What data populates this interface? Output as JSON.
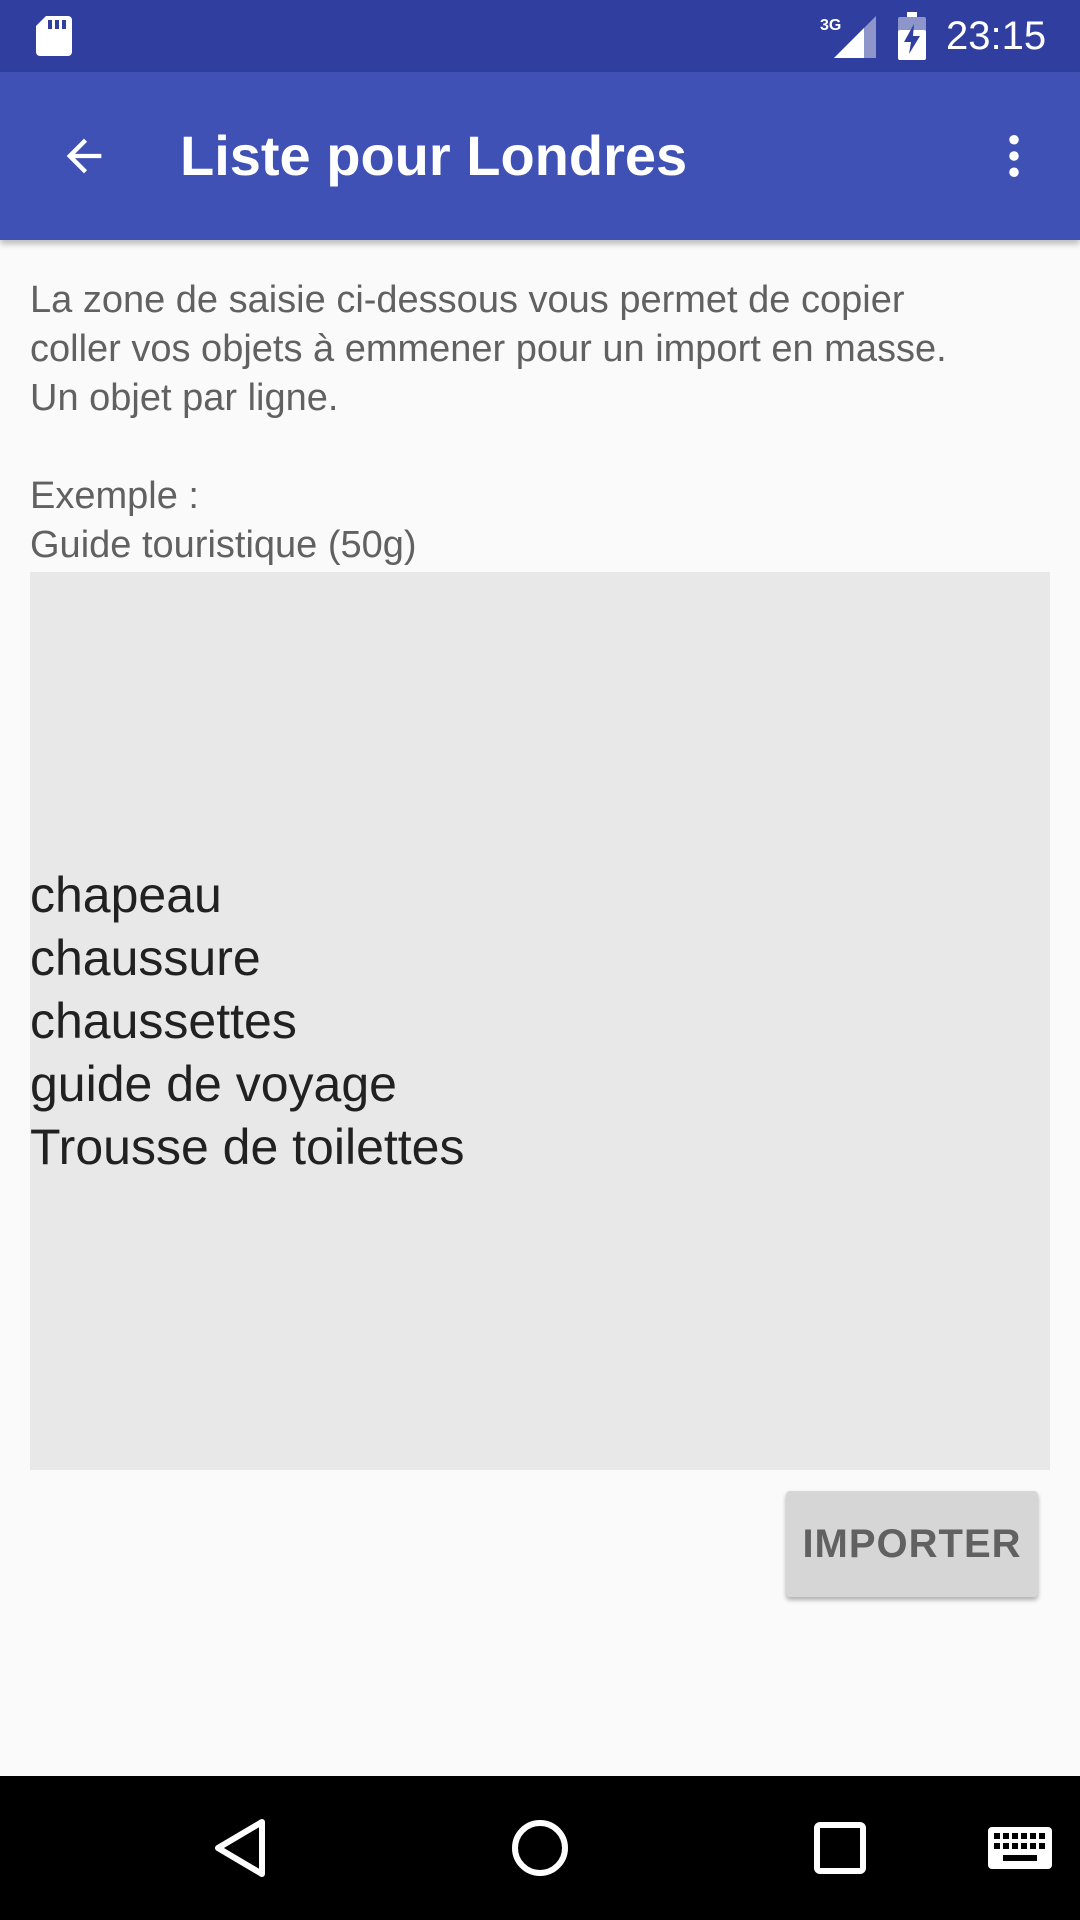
{
  "status_bar": {
    "network": "3G",
    "time": "23:15",
    "icons": [
      "sd-card-icon",
      "signal-icon",
      "battery-charging-icon"
    ]
  },
  "app_bar": {
    "title": "Liste pour Londres",
    "back_icon": "arrow-back-icon",
    "menu_icon": "more-vert-icon"
  },
  "instructions": "La zone de saisie ci-dessous vous permet de copier\ncoller vos objets à emmener pour un import en masse.\nUn objet par ligne.",
  "example": {
    "label": "Exemple :",
    "value": "Guide touristique (50g)"
  },
  "items_input": {
    "lines": [
      "chapeau",
      "chaussure",
      "chaussettes",
      "guide de voyage",
      "Trousse de toilettes"
    ]
  },
  "import_button": {
    "label": "IMPORTER"
  },
  "nav_bar": {
    "icons": [
      "back-triangle-icon",
      "home-circle-icon",
      "recents-square-icon",
      "keyboard-icon"
    ]
  },
  "colors": {
    "status_bar": "#303f9f",
    "app_bar": "#3f51b5",
    "input_background": "#e8e8e8",
    "button_background": "#d6d6d6"
  }
}
